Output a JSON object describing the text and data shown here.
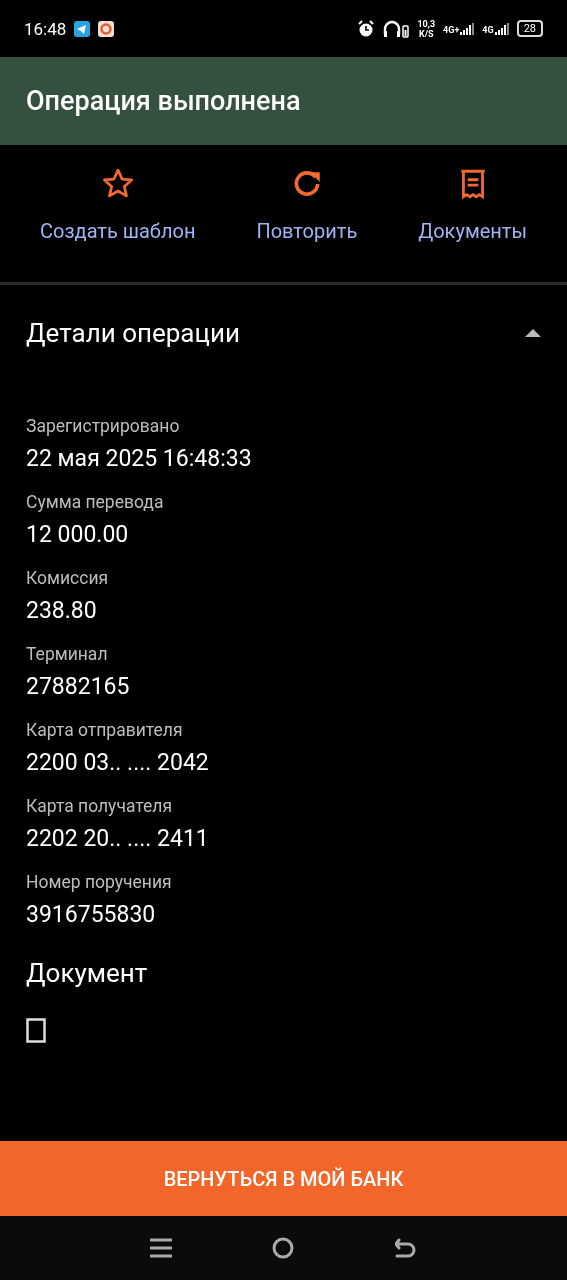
{
  "status_bar": {
    "time": "16:48",
    "speed": "10,3",
    "speed_unit": "K/S",
    "network_1": "4G+",
    "network_2": "4G",
    "battery": "28"
  },
  "header": {
    "title": "Операция выполнена"
  },
  "actions": [
    {
      "kind": "star",
      "label": "Создать шаблон"
    },
    {
      "kind": "repeat",
      "label": "Повторить"
    },
    {
      "kind": "receipt",
      "label": "Документы"
    }
  ],
  "details": {
    "title": "Детали операции",
    "expanded": true,
    "fields": [
      {
        "label": "Зарегистрировано",
        "value": "22 мая 2025 16:48:33"
      },
      {
        "label": "Сумма перевода",
        "value": "12 000.00"
      },
      {
        "label": "Комиссия",
        "value": "238.80"
      },
      {
        "label": "Терминал",
        "value": "27882165"
      },
      {
        "label": "Карта отправителя",
        "value": "2200 03.. .... 2042"
      },
      {
        "label": "Карта получателя",
        "value": "2202 20.. .... 2411"
      },
      {
        "label": "Номер поручения",
        "value": "3916755830"
      }
    ]
  },
  "document": {
    "title": "Документ"
  },
  "bottom_button": {
    "label": "ВЕРНУТЬСЯ В МОЙ БАНК"
  }
}
